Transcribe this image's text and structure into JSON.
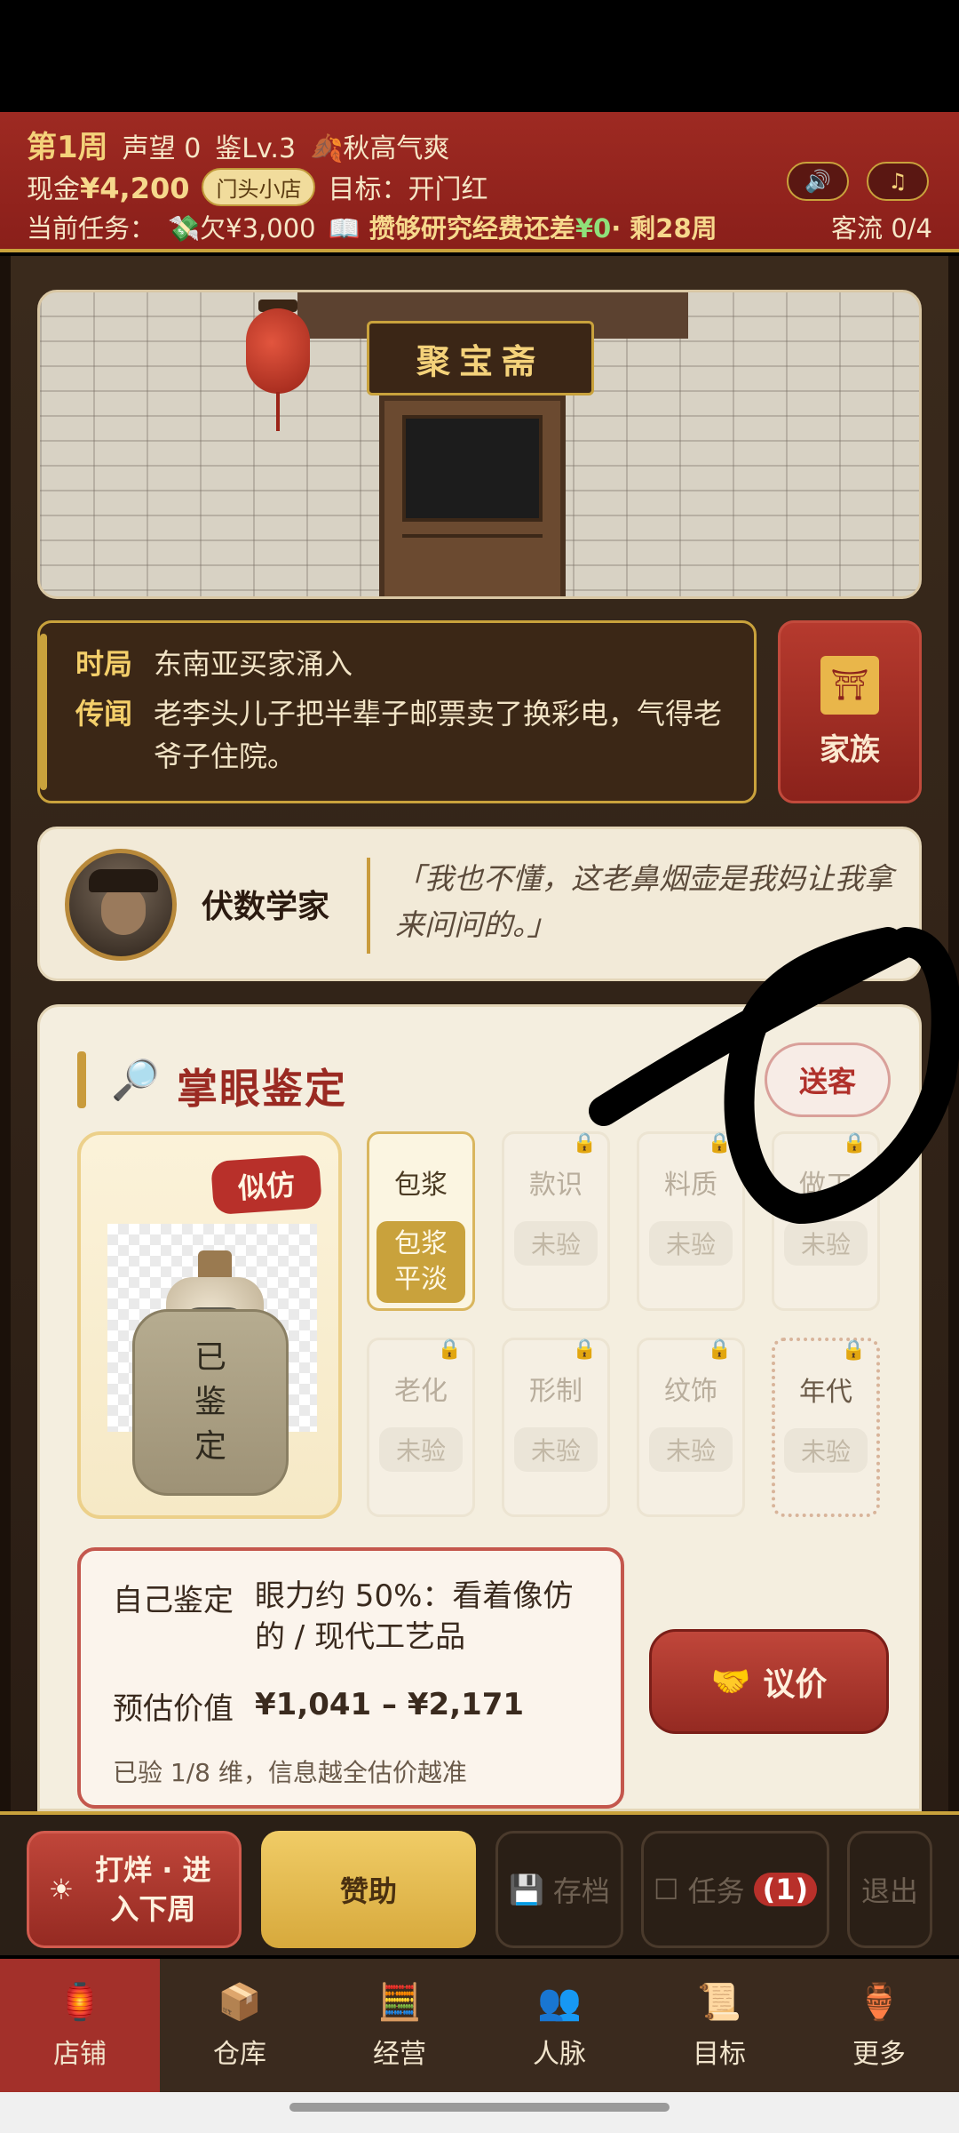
{
  "header": {
    "week": "第1周",
    "reputation": "声望 0",
    "appraisal_level": "鉴Lv.3",
    "season": "🍂秋高气爽",
    "cash_label": "现金",
    "cash_value": "¥4,200",
    "shop_level": "门头小店",
    "goal": "目标：开门红",
    "task_label": "当前任务：",
    "task_debt": "💸欠¥3,000",
    "task_goal_prefix": "📖 攒够研究经费还差",
    "task_goal_amount": "¥0",
    "task_goal_suffix": "· 剩28周",
    "customer_flow": "客流 0/4",
    "sound_icon": "speaker-icon",
    "music_icon": "music-icon"
  },
  "shop": {
    "name": "聚宝斋"
  },
  "event": {
    "situation_label": "时局",
    "situation_text": "东南亚买家涌入",
    "rumor_label": "传闻",
    "rumor_text": "老李头儿子把半辈子邮票卖了换彩电，气得老爷子住院。"
  },
  "family_button": {
    "label": "家族"
  },
  "customer": {
    "name": "伏数学家",
    "quote": "「我也不懂，这老鼻烟壶是我妈让我拿来问问的。」"
  },
  "appraisal": {
    "title": "掌眼鉴定",
    "send_off": "送客",
    "verdict_tag": "似仿",
    "identified_label": [
      "已",
      "鉴",
      "定"
    ],
    "checks": [
      {
        "name": "包浆",
        "status": [
          "包浆",
          "平淡"
        ],
        "done": true
      },
      {
        "name": "款识",
        "status": "未验",
        "locked": true
      },
      {
        "name": "料质",
        "status": "未验",
        "locked": true
      },
      {
        "name": "做工",
        "status": "未验",
        "locked": true
      },
      {
        "name": "老化",
        "status": "未验",
        "locked": true
      },
      {
        "name": "形制",
        "status": "未验",
        "locked": true
      },
      {
        "name": "纹饰",
        "status": "未验",
        "locked": true
      },
      {
        "name": "年代",
        "status": "未验",
        "locked": true
      }
    ],
    "self_label": "自己鉴定",
    "self_value": "眼力约 50%：看着像仿的 / 现代工艺品",
    "estimate_label": "预估价值",
    "estimate_value": "¥1,041 – ¥2,171",
    "note": "已验 1/8 维，信息越全估价越准",
    "bargain": "议价"
  },
  "actions": {
    "next_week": "打烊 · 进入下周",
    "sponsor": "赞助",
    "save": "存档",
    "task": "任务",
    "task_count": "(1)",
    "quit": "退出"
  },
  "nav": [
    {
      "label": "店铺",
      "icon": "storefront-icon",
      "active": true
    },
    {
      "label": "仓库",
      "icon": "warehouse-icon",
      "active": false
    },
    {
      "label": "经营",
      "icon": "abacus-icon",
      "active": false
    },
    {
      "label": "人脉",
      "icon": "people-icon",
      "active": false
    },
    {
      "label": "目标",
      "icon": "scroll-icon",
      "active": false
    },
    {
      "label": "更多",
      "icon": "more-icon",
      "active": false
    }
  ],
  "colors": {
    "header_red": "#9e2a22",
    "gold": "#c9a23c",
    "accent_red": "#b8302a",
    "panel_cream": "#f4eedf"
  }
}
